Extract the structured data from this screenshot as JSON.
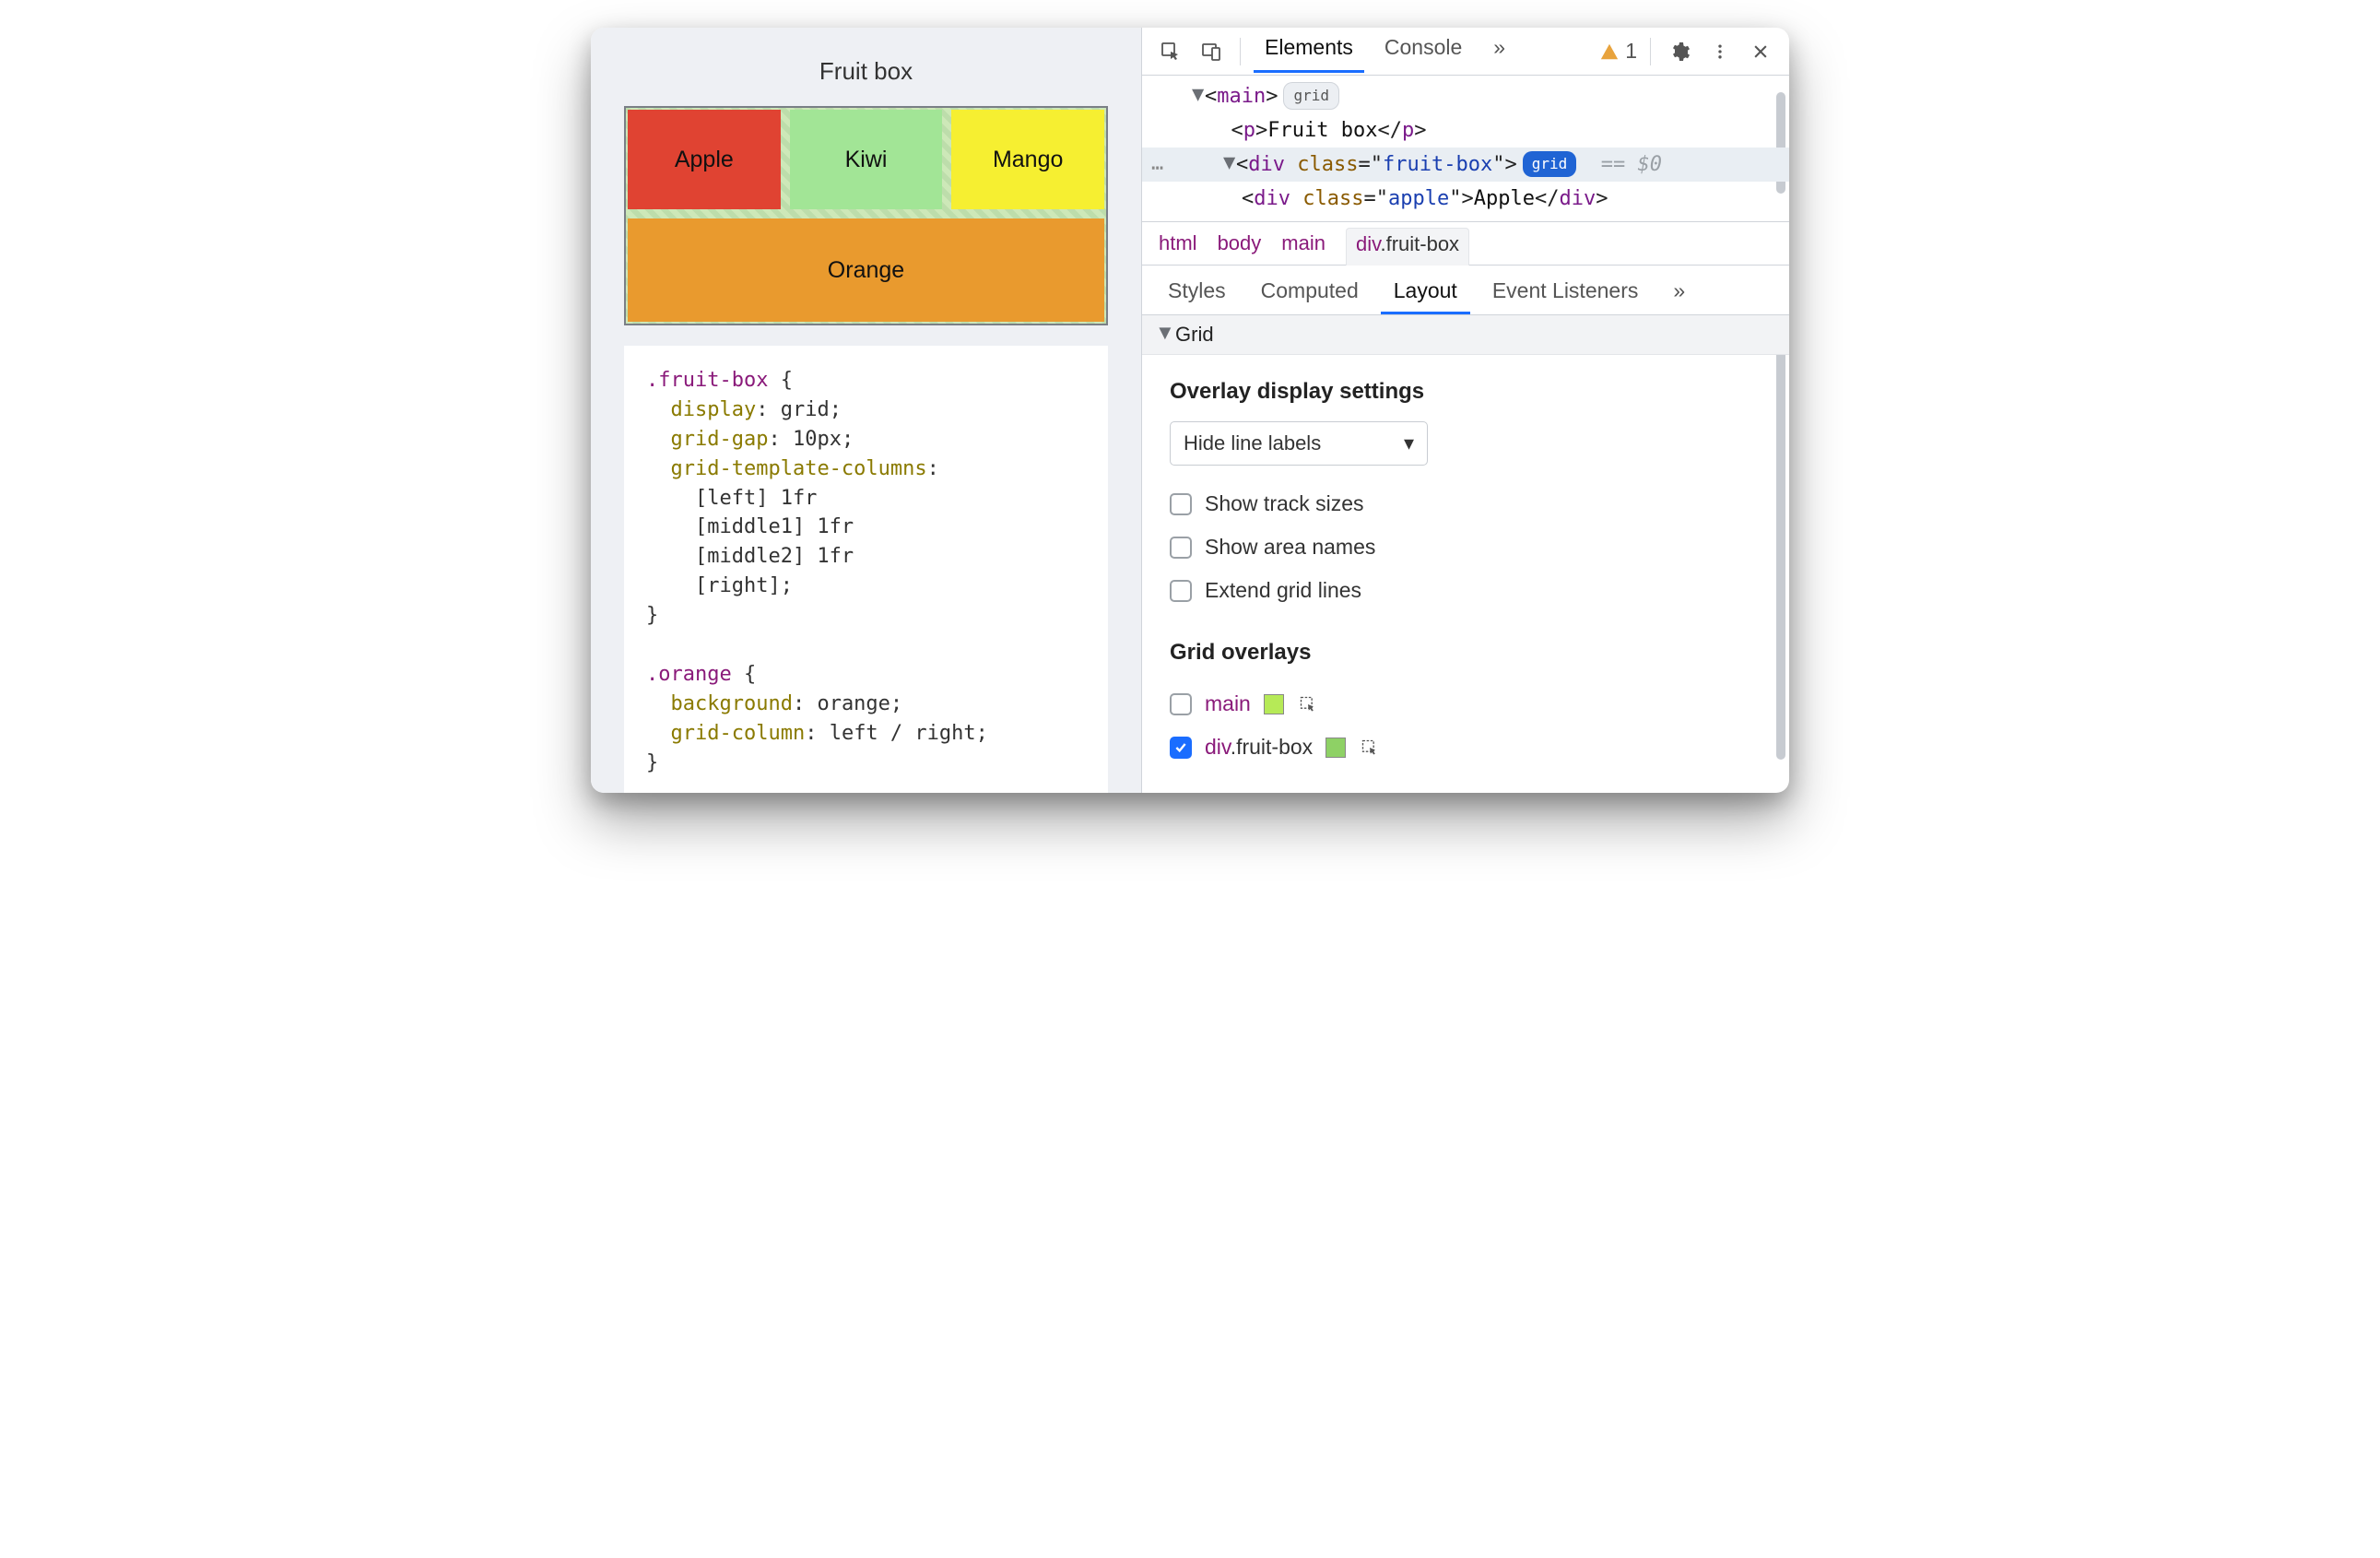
{
  "page": {
    "title": "Fruit box",
    "cells": {
      "apple": "Apple",
      "kiwi": "Kiwi",
      "mango": "Mango",
      "orange": "Orange"
    },
    "css_lines": [
      {
        "t": "sel",
        "s": ".fruit-box {"
      },
      {
        "t": "prop",
        "s": "  display: grid;"
      },
      {
        "t": "prop",
        "s": "  grid-gap: 10px;"
      },
      {
        "t": "prop",
        "s": "  grid-template-columns:"
      },
      {
        "t": "val",
        "s": "    [left] 1fr"
      },
      {
        "t": "val",
        "s": "    [middle1] 1fr"
      },
      {
        "t": "val",
        "s": "    [middle2] 1fr"
      },
      {
        "t": "val",
        "s": "    [right];"
      },
      {
        "t": "sel",
        "s": "}"
      },
      {
        "t": "blank",
        "s": ""
      },
      {
        "t": "sel",
        "s": ".orange {"
      },
      {
        "t": "prop",
        "s": "  background: orange;"
      },
      {
        "t": "prop",
        "s": "  grid-column: left / right;"
      },
      {
        "t": "sel",
        "s": "}"
      }
    ]
  },
  "devtools": {
    "tabs": {
      "elements": "Elements",
      "console": "Console",
      "more": "»"
    },
    "warning_count": "1",
    "dom": {
      "main_open": "main",
      "main_badge": "grid",
      "p_text": "Fruit box",
      "div_class": "fruit-box",
      "div_badge": "grid",
      "eq": "== $0",
      "child_class": "apple",
      "child_text": "Apple"
    },
    "crumbs": [
      "html",
      "body",
      "main",
      "div.fruit-box"
    ],
    "subtabs": {
      "styles": "Styles",
      "computed": "Computed",
      "layout": "Layout",
      "listeners": "Event Listeners",
      "more": "»"
    },
    "layout": {
      "section": "Grid",
      "overlay_heading": "Overlay display settings",
      "select_value": "Hide line labels",
      "checks": {
        "track_sizes": "Show track sizes",
        "area_names": "Show area names",
        "extend": "Extend grid lines"
      },
      "grid_overlays_heading": "Grid overlays",
      "overlays": [
        {
          "checked": false,
          "name": "main",
          "swatch": "#b6ea57"
        },
        {
          "checked": true,
          "name": "div.fruit-box",
          "swatch": "#8ed165"
        }
      ]
    }
  }
}
